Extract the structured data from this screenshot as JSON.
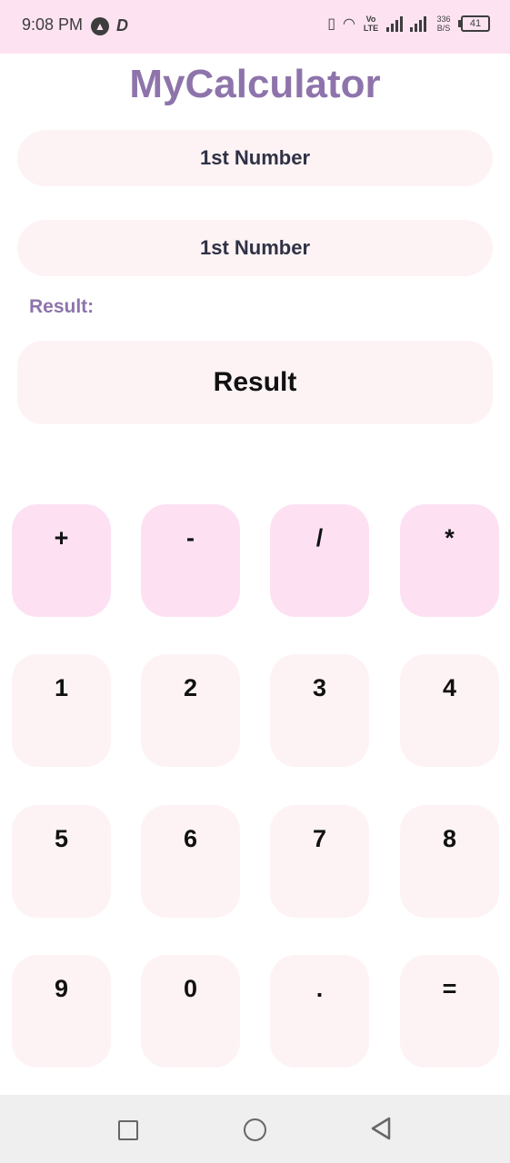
{
  "status_bar": {
    "time": "9:08 PM",
    "left_icons": [
      "app-a-icon",
      "app-d-icon"
    ],
    "net_type": "Vo LTE",
    "speed": "336 B/S",
    "battery": "41"
  },
  "app": {
    "title": "MyCalculator",
    "field1_placeholder": "1st Number",
    "field2_placeholder": "1st Number",
    "result_label": "Result:",
    "result_value": "Result"
  },
  "keypad": {
    "operators": [
      "+",
      "-",
      "/",
      "*"
    ],
    "row1": [
      "1",
      "2",
      "3",
      "4"
    ],
    "row2": [
      "5",
      "6",
      "7",
      "8"
    ],
    "row3": [
      "9",
      "0",
      ".",
      "="
    ]
  },
  "colors": {
    "accent": "#8e74ab",
    "status_bar_bg": "#fde3f1",
    "field_bg": "#fdf3f5",
    "operator_bg": "#fde1f2"
  },
  "nav_bar": {
    "buttons": [
      "recents-square-icon",
      "home-circle-icon",
      "back-triangle-icon"
    ]
  }
}
